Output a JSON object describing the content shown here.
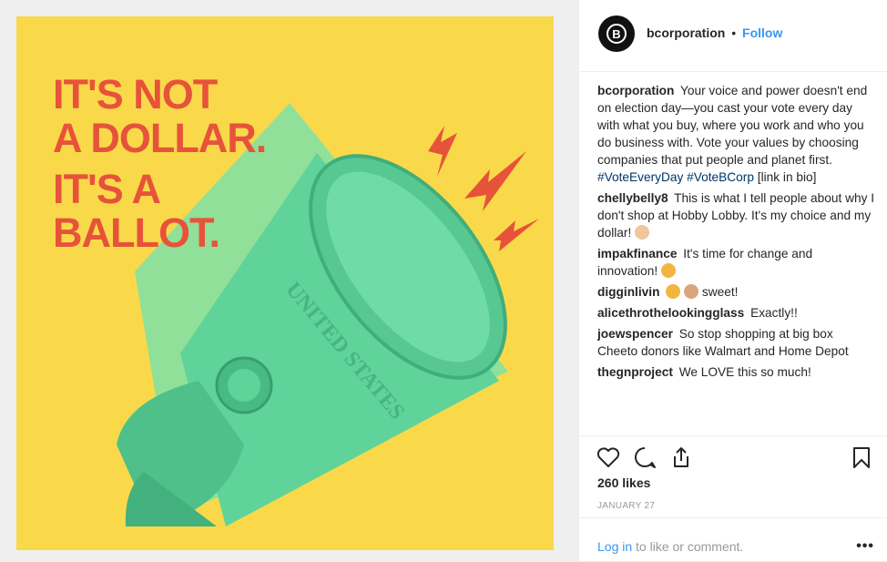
{
  "image": {
    "headline": [
      "IT'S NOT",
      "A DOLLAR.",
      "IT'S A",
      "BALLOT."
    ],
    "bill_text": "UNITED STATES",
    "colors": {
      "background": "#f9d94a",
      "headline": "#e7533a",
      "bill": "#5fd39a"
    }
  },
  "header": {
    "avatar_letter": "B",
    "username": "bcorporation",
    "separator": "•",
    "follow_label": "Follow"
  },
  "comments": [
    {
      "user": "bcorporation",
      "text": "Your voice and power doesn't end on election day—you cast your vote every day with what you buy, where you work and who you do business with. Vote your values by choosing companies that put people and planet first.",
      "tags": "#VoteEveryDay #VoteBCorp",
      "tail": "[link in bio]"
    },
    {
      "user": "chellybelly8",
      "text": "This is what I tell people about why I don't shop at Hobby Lobby. It's my choice and my dollar!"
    },
    {
      "user": "impakfinance",
      "text": "It's time for change and innovation!"
    },
    {
      "user": "digginlivin",
      "text": "sweet!"
    },
    {
      "user": "alicethrothelookingglass",
      "text": "Exactly!!"
    },
    {
      "user": "joewspencer",
      "text": "So stop shopping at big box Cheeto donors like Walmart and Home Depot"
    },
    {
      "user": "thegnproject",
      "text": "We LOVE this so much!"
    }
  ],
  "icons": {
    "like": "heart-icon",
    "comment": "comment-icon",
    "share": "share-icon",
    "save": "bookmark-icon",
    "more": "more-options-icon"
  },
  "likes": "260 likes",
  "date": "JANUARY 27",
  "footer": {
    "login_link": "Log in",
    "login_rest": "to like or comment.",
    "more": "•••"
  }
}
